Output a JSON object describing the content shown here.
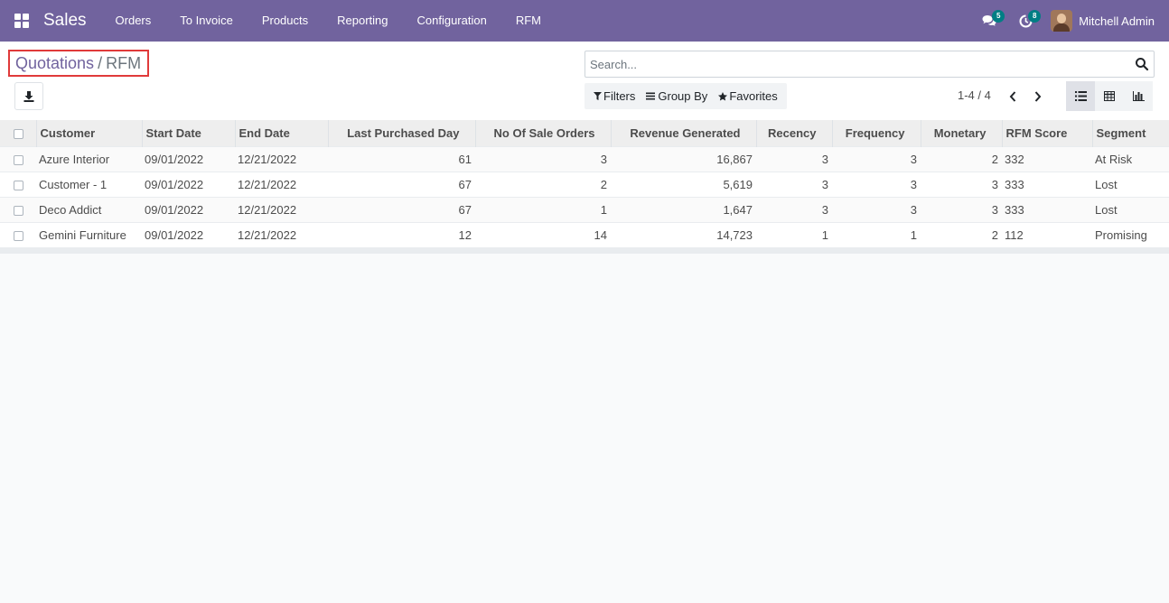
{
  "navbar": {
    "brand": "Sales",
    "menu": [
      "Orders",
      "To Invoice",
      "Products",
      "Reporting",
      "Configuration",
      "RFM"
    ],
    "messages_badge": "5",
    "activities_badge": "8",
    "user_name": "Mitchell Admin",
    "bg_color": "#71639e"
  },
  "breadcrumb": {
    "parent": "Quotations",
    "separator": "/",
    "current": "RFM"
  },
  "search": {
    "placeholder": "Search..."
  },
  "filters": {
    "filters_label": "Filters",
    "group_by_label": "Group By",
    "favorites_label": "Favorites"
  },
  "pager": {
    "range": "1-4 / 4"
  },
  "table": {
    "columns": [
      "Customer",
      "Start Date",
      "End Date",
      "Last Purchased Day",
      "No Of Sale Orders",
      "Revenue Generated",
      "Recency",
      "Frequency",
      "Monetary",
      "RFM Score",
      "Segment"
    ],
    "rows": [
      [
        "Azure Interior",
        "09/01/2022",
        "12/21/2022",
        "61",
        "3",
        "16,867",
        "3",
        "3",
        "2",
        "332",
        "At Risk"
      ],
      [
        "Customer - 1",
        "09/01/2022",
        "12/21/2022",
        "67",
        "2",
        "5,619",
        "3",
        "3",
        "3",
        "333",
        "Lost"
      ],
      [
        "Deco Addict",
        "09/01/2022",
        "12/21/2022",
        "67",
        "1",
        "1,647",
        "3",
        "3",
        "3",
        "333",
        "Lost"
      ],
      [
        "Gemini Furniture",
        "09/01/2022",
        "12/21/2022",
        "12",
        "14",
        "14,723",
        "1",
        "1",
        "2",
        "112",
        "Promising"
      ]
    ]
  }
}
